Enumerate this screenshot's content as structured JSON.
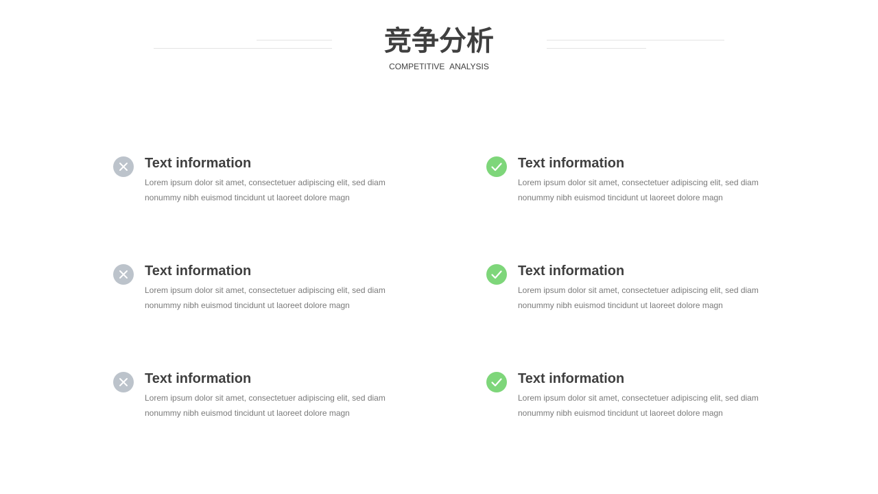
{
  "header": {
    "title": "竞争分析",
    "subtitle": "COMPETITIVE  ANALYSIS"
  },
  "colors": {
    "negative_icon": "#bcc3cb",
    "positive_icon": "#7ed67a",
    "title_text": "#3f3f3f",
    "body_text": "#7a7a7a"
  },
  "left_items": [
    {
      "icon": "cross-icon",
      "title": "Text information",
      "body": "Lorem ipsum dolor sit amet, consectetuer adipiscing elit, sed diam nonummy nibh euismod tincidunt ut laoreet dolore magn"
    },
    {
      "icon": "cross-icon",
      "title": "Text information",
      "body": "Lorem ipsum dolor sit amet, consectetuer adipiscing elit, sed diam nonummy nibh euismod tincidunt ut laoreet dolore magn"
    },
    {
      "icon": "cross-icon",
      "title": "Text information",
      "body": "Lorem ipsum dolor sit amet, consectetuer adipiscing elit, sed diam nonummy nibh euismod tincidunt ut laoreet dolore magn"
    }
  ],
  "right_items": [
    {
      "icon": "check-icon",
      "title": "Text information",
      "body": "Lorem ipsum dolor sit amet, consectetuer adipiscing elit, sed diam nonummy nibh euismod tincidunt ut laoreet dolore magn"
    },
    {
      "icon": "check-icon",
      "title": "Text information",
      "body": "Lorem ipsum dolor sit amet, consectetuer adipiscing elit, sed diam nonummy nibh euismod tincidunt ut laoreet dolore magn"
    },
    {
      "icon": "check-icon",
      "title": "Text information",
      "body": "Lorem ipsum dolor sit amet, consectetuer adipiscing elit, sed diam nonummy nibh euismod tincidunt ut laoreet dolore magn"
    }
  ]
}
